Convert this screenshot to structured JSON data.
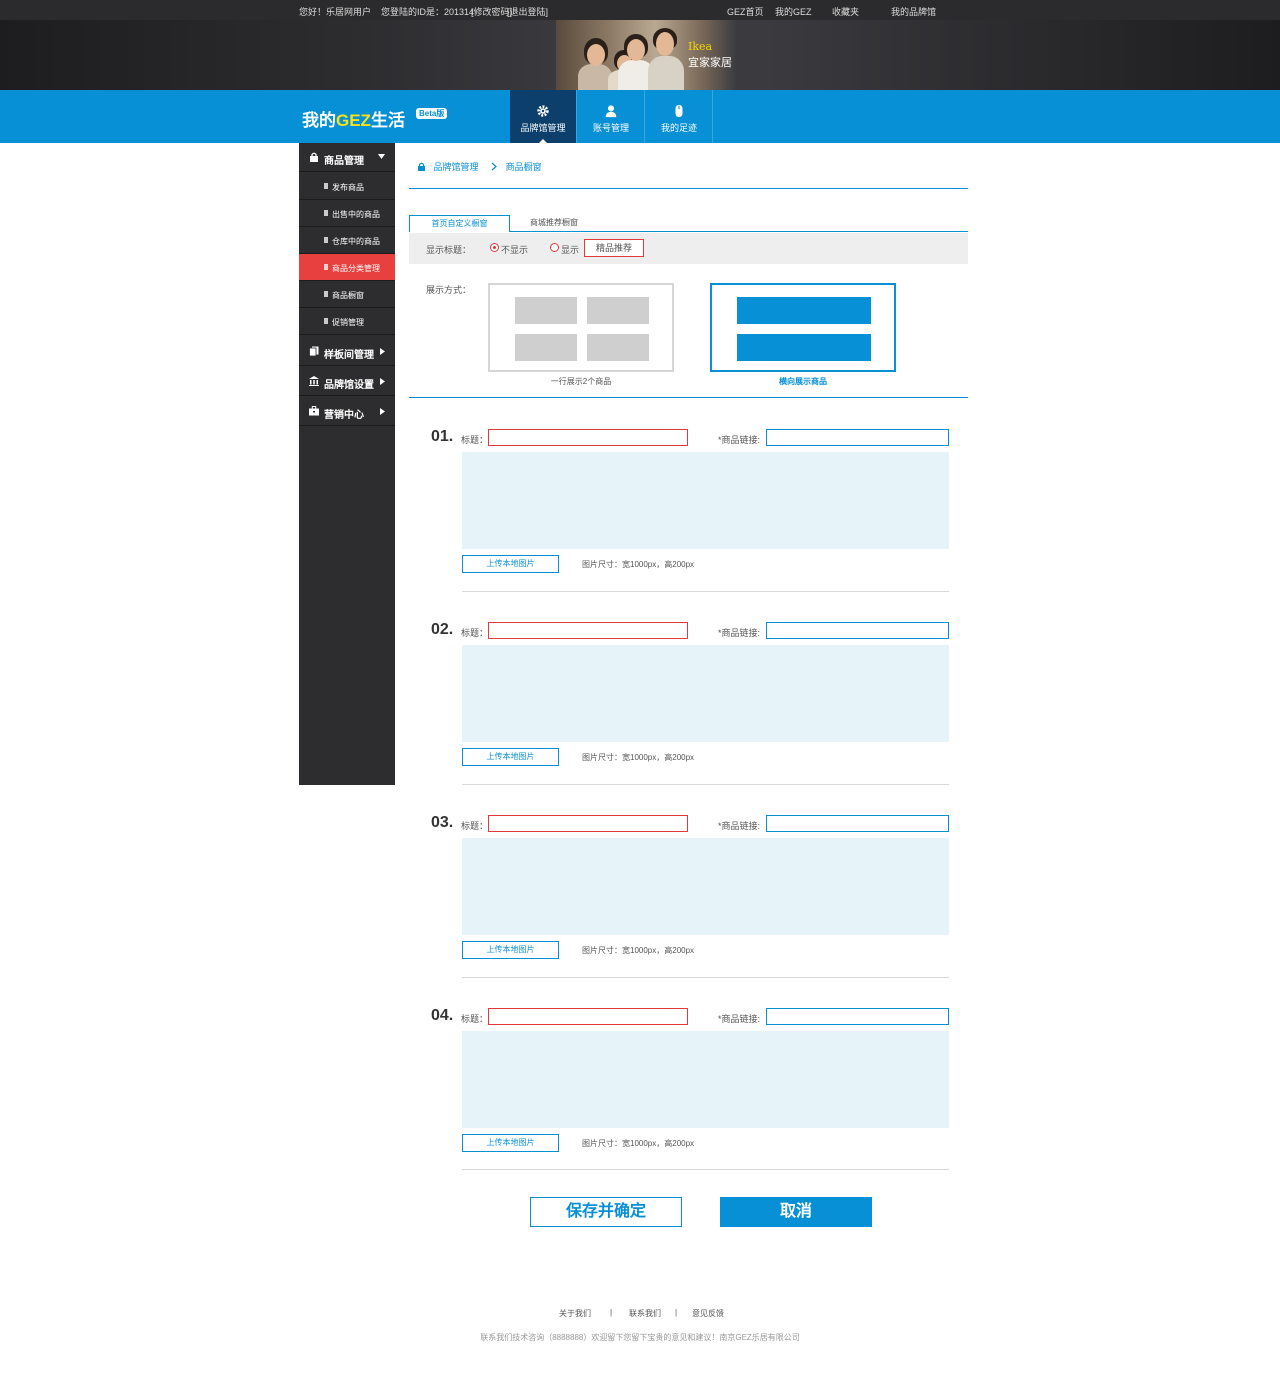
{
  "topbar": {
    "greeting": "您好！乐居网用户",
    "login_id": "您登陆的ID是：201314",
    "change_pwd": "[修改密码]",
    "logout": "[退出登陆]",
    "links": [
      "GEZ首页",
      "我的GEZ",
      "收藏夹",
      "我的品牌馆"
    ]
  },
  "banner": {
    "brand_en": "Ikea",
    "brand_cn": "宜家家居"
  },
  "nav": {
    "logo_prefix": "我的",
    "logo_brand": "GEZ",
    "logo_suffix": "生活",
    "beta": "Beta版",
    "tabs": [
      {
        "label": "品牌馆管理",
        "icon": "gear-icon"
      },
      {
        "label": "账号管理",
        "icon": "user-icon"
      },
      {
        "label": "我的足迹",
        "icon": "mouse-icon"
      }
    ]
  },
  "sidebar": {
    "product_mgmt": "商品管理",
    "items": [
      "发布商品",
      "出售中的商品",
      "仓库中的商品",
      "商品分类管理",
      "商品橱窗",
      "促销管理"
    ],
    "active_index": 3,
    "sample_room": "样板间管理",
    "brand_settings": "品牌馆设置",
    "marketing": "营销中心"
  },
  "breadcrumb": {
    "root": "品牌馆管理",
    "current": "商品橱窗"
  },
  "tabs": {
    "custom": "首页自定义橱窗",
    "recommend": "商城推荐橱窗"
  },
  "options": {
    "show_title_label": "显示标题：",
    "hide": "不显示",
    "show": "显示",
    "title_value": "精品推荐",
    "display_label": "展示方式：",
    "layout_a": "一行展示2个商品",
    "layout_b": "横向展示商品"
  },
  "slots": [
    {
      "num": "01.",
      "title_label": "标题：",
      "link_label": "*商品链接:",
      "upload": "上传本地图片",
      "size": "图片尺寸：宽1000px，高200px"
    },
    {
      "num": "02.",
      "title_label": "标题：",
      "link_label": "*商品链接:",
      "upload": "上传本地图片",
      "size": "图片尺寸：宽1000px，高200px"
    },
    {
      "num": "03.",
      "title_label": "标题：",
      "link_label": "*商品链接:",
      "upload": "上传本地图片",
      "size": "图片尺寸：宽1000px，高200px"
    },
    {
      "num": "04.",
      "title_label": "标题：",
      "link_label": "*商品链接:",
      "upload": "上传本地图片",
      "size": "图片尺寸：宽1000px，高200px"
    }
  ],
  "actions": {
    "save": "保存并确定",
    "cancel": "取消"
  },
  "footer": {
    "links": [
      "关于我们",
      "联系我们",
      "意见反馈"
    ],
    "sep": "|",
    "contact": "联系我们技术咨询（8888888）欢迎留下您留下宝贵的意见和建议！南京GEZ乐居有限公司"
  },
  "colors": {
    "brand_blue": "#0790d6",
    "accent_red": "#e23a3a",
    "nav_active": "#0d3f6c",
    "sidebar_bg": "#2d2d2f"
  }
}
